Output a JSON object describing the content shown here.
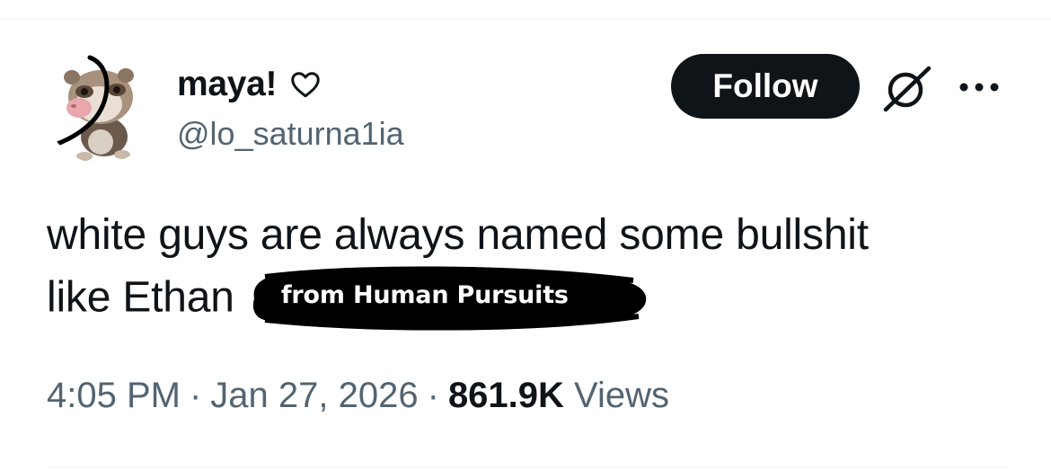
{
  "author": {
    "display_name": "maya!",
    "handle": "@lo_saturna1ia",
    "avatar_icon": "ferret-photo",
    "name_icon": "heart-outline-icon"
  },
  "actions": {
    "follow_label": "Follow",
    "grok_icon": "grok-icon",
    "more_icon": "more-dots-icon"
  },
  "tweet": {
    "line1": "white guys are always named some bullshit",
    "line2": "like Ethan",
    "overlay_text": "from Human Pursuits"
  },
  "meta": {
    "time": "4:05 PM",
    "separator": "·",
    "date": "Jan 27, 2026",
    "views_count": "861.9K",
    "views_label": "Views"
  },
  "colors": {
    "text": "#0f1419",
    "secondary": "#536471",
    "button_bg": "#0f1419"
  }
}
